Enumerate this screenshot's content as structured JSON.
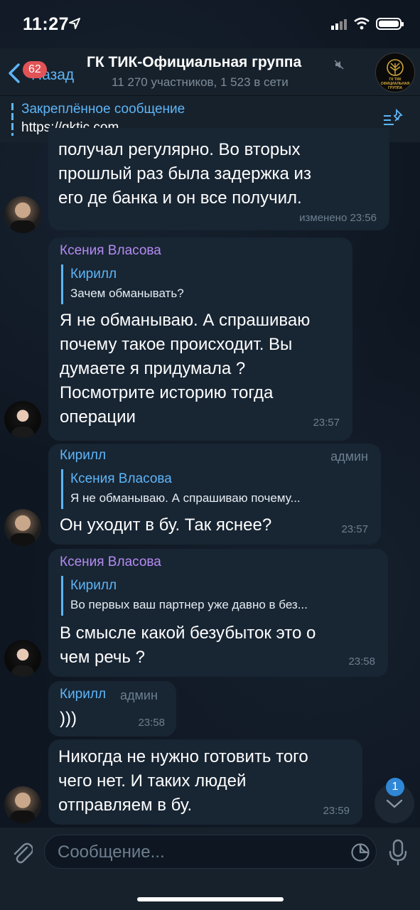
{
  "status_bar": {
    "time": "11:27"
  },
  "header": {
    "back_label": "Назад",
    "back_badge": "62",
    "title": "ГК ТИК-Официальная группа",
    "subtitle": "11 270 участников, 1 523 в сети",
    "logo_text": "ГК ТИК ОФИЦИАЛЬНАЯ ГРУППА"
  },
  "pinned": {
    "title": "Закреплённое сообщение",
    "text": "https://gktic.com"
  },
  "messages": [
    {
      "lines": [
        "получал регулярно. Во вторых",
        "прошлый раз была задержка из",
        "его де банка и он все получил."
      ],
      "meta": "изменено 23:56"
    },
    {
      "sender": "Ксения Власова",
      "reply_name": "Кирилл",
      "reply_text": "Зачем обманывать?",
      "lines": [
        "Я не обманываю. А спрашиваю",
        "почему такое происходит. Вы",
        "думаете я придумала ?",
        "Посмотрите историю тогда",
        "операции"
      ],
      "time": "23:57"
    },
    {
      "sender": "Кирилл",
      "badge": "админ",
      "reply_name": "Ксения Власова",
      "reply_text": "Я не обманываю. А спрашиваю почему...",
      "lines": [
        "Он уходит в бу. Так яснее?"
      ],
      "time": "23:57"
    },
    {
      "sender": "Ксения Власова",
      "reply_name": "Кирилл",
      "reply_text": "Во первых ваш партнер уже давно в без...",
      "lines": [
        "В смысле какой безубыток это о",
        "чем речь ?"
      ],
      "time": "23:58"
    },
    {
      "sender": "Кирилл",
      "badge": "админ",
      "lines": [
        ")))"
      ],
      "time": "23:58"
    },
    {
      "lines": [
        "Никогда не нужно готовить того",
        "чего нет. И таких людей",
        "отправляем в бу."
      ],
      "time": "23:59"
    }
  ],
  "scroll_badge": "1",
  "input": {
    "placeholder": "Сообщение..."
  },
  "colors": {
    "accent": "#5eb5f7",
    "bubble": "#182533",
    "background": "#0e1621",
    "sender_purple": "#b48bf2"
  }
}
